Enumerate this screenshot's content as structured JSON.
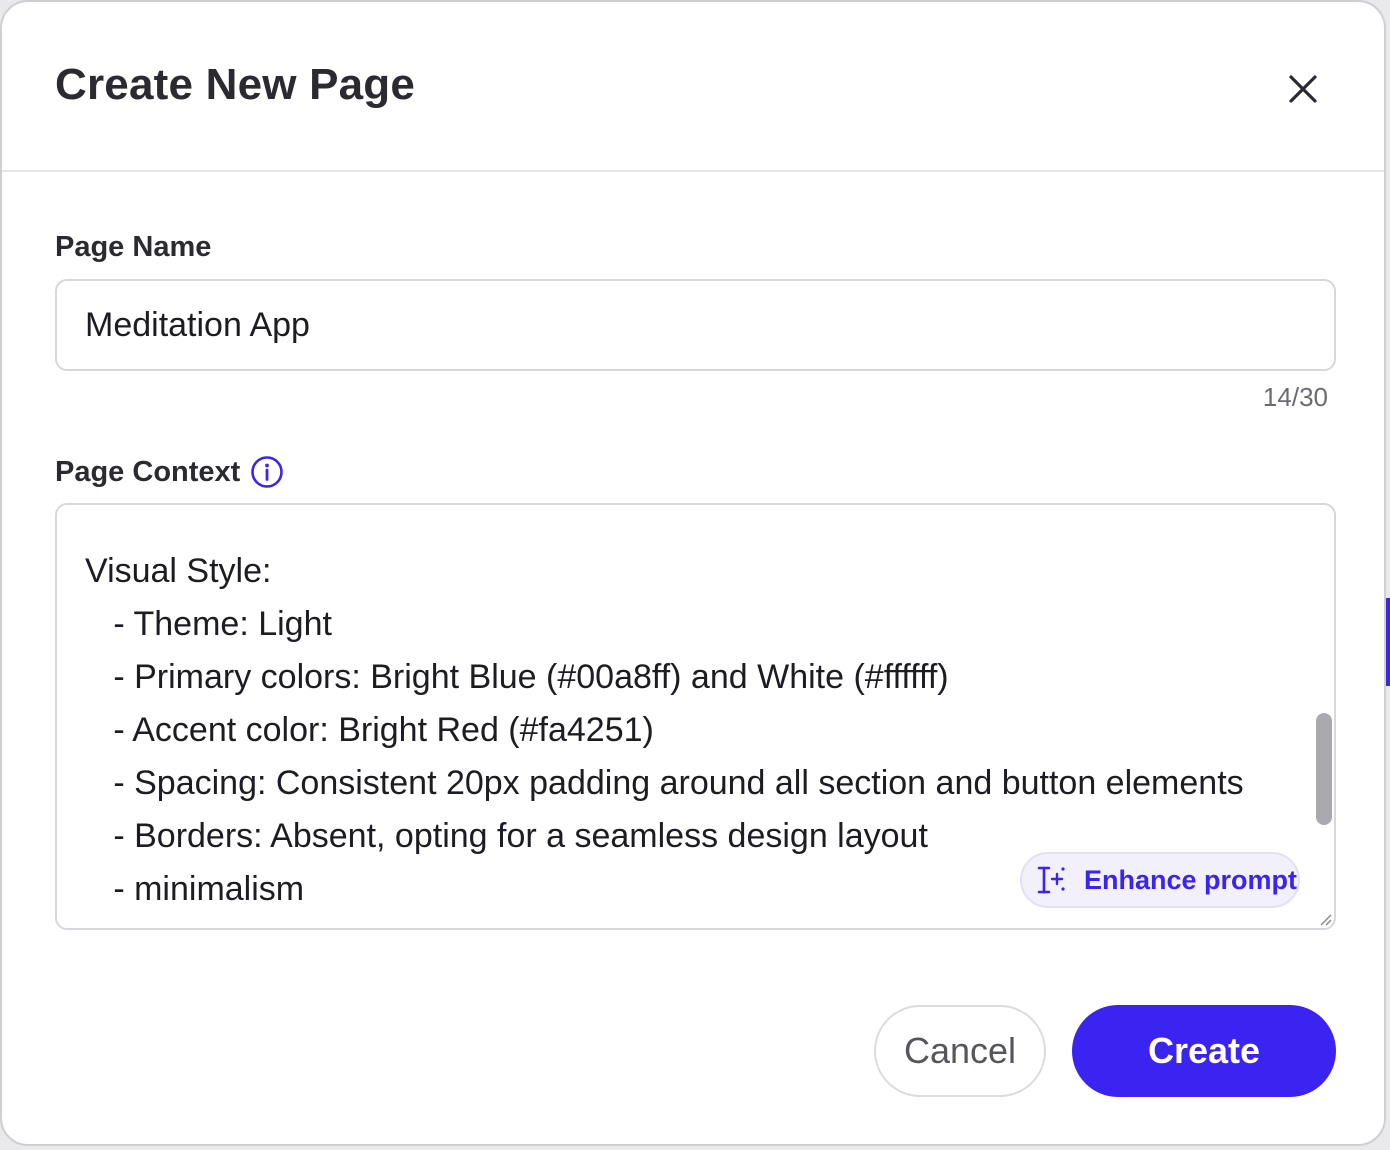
{
  "dialog": {
    "title": "Create New Page"
  },
  "page_name": {
    "label": "Page Name",
    "value": "Meditation App",
    "counter": "14/30"
  },
  "page_context": {
    "label": "Page Context",
    "value": "Visual Style:\n   - Theme: Light\n   - Primary colors: Bright Blue (#00a8ff) and White (#ffffff)\n   - Accent color: Bright Red (#fa4251)\n   - Spacing: Consistent 20px padding around all section and button elements\n   - Borders: Absent, opting for a seamless design layout\n   - minimalism",
    "enhance_label": "Enhance prompt"
  },
  "actions": {
    "cancel_label": "Cancel",
    "create_label": "Create"
  },
  "colors": {
    "accent": "#3b23f2",
    "enhance_bg": "#f1f0fb"
  },
  "icons": {
    "close": "close-icon",
    "info": "info-icon",
    "enhance": "text-cursor-sparkle-icon"
  }
}
